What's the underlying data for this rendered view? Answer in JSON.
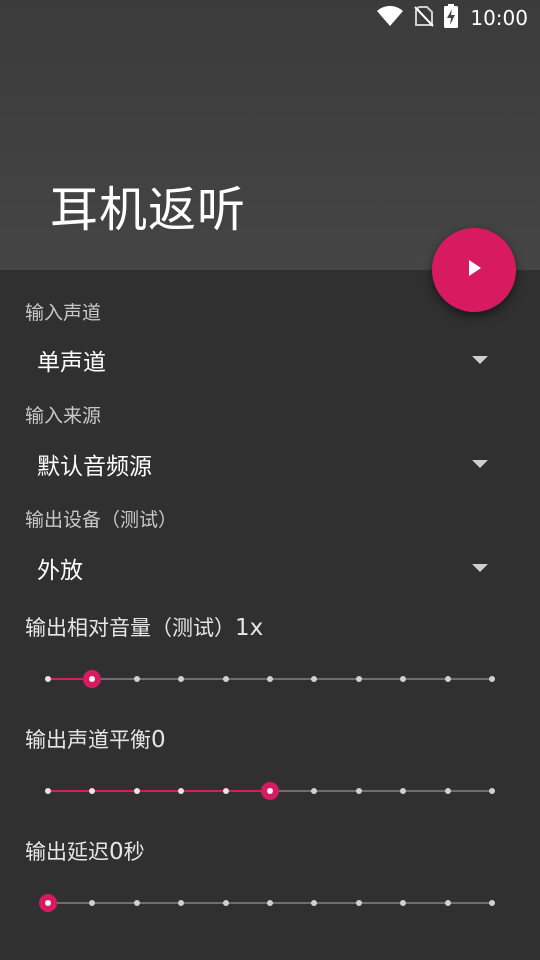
{
  "status_bar": {
    "time": "10:00",
    "icons": [
      "wifi-icon",
      "no-sim-icon",
      "battery-charging-icon"
    ]
  },
  "header": {
    "title": "耳机返听"
  },
  "fab": {
    "icon": "play-icon",
    "color": "#d81b60"
  },
  "settings": {
    "input_channel": {
      "label": "输入声道",
      "value": "单声道"
    },
    "input_source": {
      "label": "输入来源",
      "value": "默认音频源"
    },
    "output_device": {
      "label": "输出设备（测试）",
      "value": "外放"
    }
  },
  "sliders": {
    "volume": {
      "label": "输出相对音量（测试）",
      "value_text": "1x",
      "steps": 10,
      "position": 1
    },
    "balance": {
      "label": "输出声道平衡",
      "value_text": "0",
      "steps": 10,
      "position": 5
    },
    "delay": {
      "label": "输出延迟",
      "value_text": "0",
      "unit": "秒",
      "steps": 10,
      "position": 0
    }
  },
  "colors": {
    "accent": "#d81b60",
    "background": "#303030",
    "app_bar": "#424242"
  }
}
